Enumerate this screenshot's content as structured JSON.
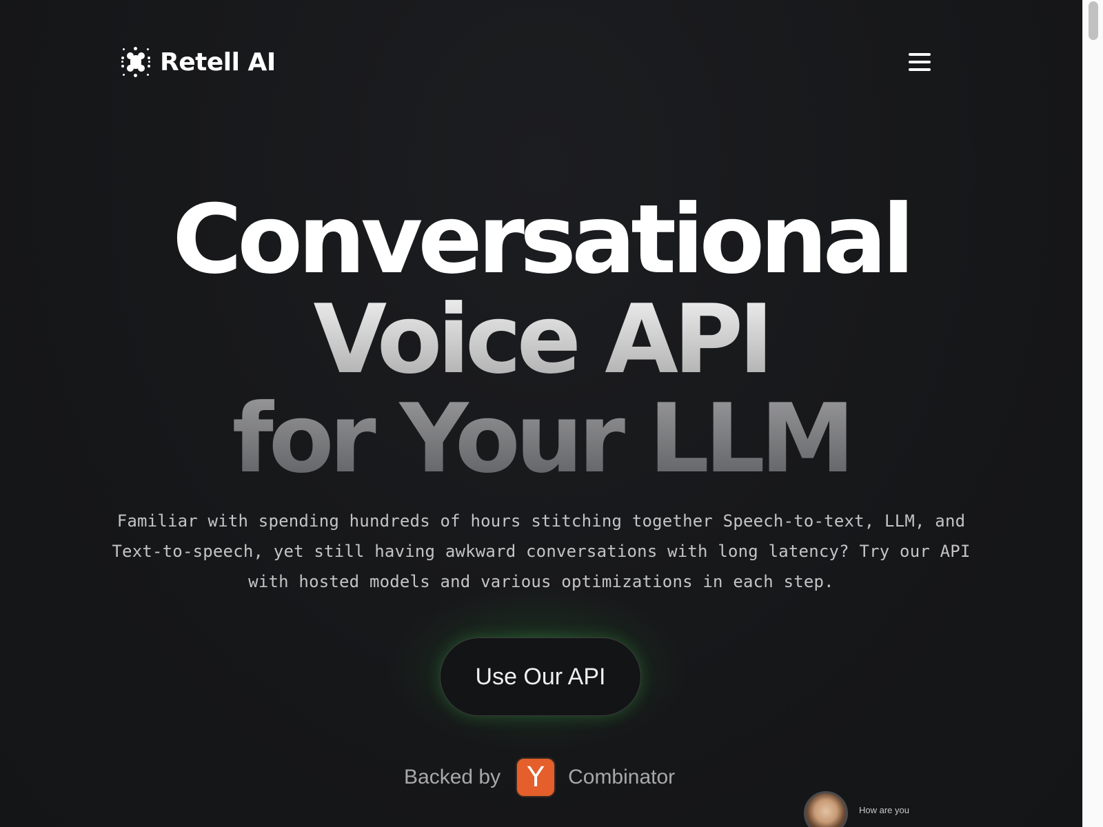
{
  "header": {
    "brand": "Retell AI",
    "menu_icon": "hamburger-menu-icon"
  },
  "hero": {
    "headline_line1": "Conversational",
    "headline_line2": "Voice API",
    "headline_line3": "for Your LLM",
    "subtitle": "Familiar with spending hundreds of hours stitching together Speech-to-text, LLM, and Text-to-speech, yet still having awkward conversations with long latency? Try our API with hosted models and various optimizations in each step.",
    "cta_label": "Use Our API"
  },
  "backed": {
    "prefix": "Backed by",
    "badge_letter": "Y",
    "suffix": "Combinator",
    "badge_color": "#e45f2b"
  },
  "chat_preview": {
    "message": "How are you"
  },
  "colors": {
    "background": "#161719",
    "glow": "#3cbe50"
  }
}
